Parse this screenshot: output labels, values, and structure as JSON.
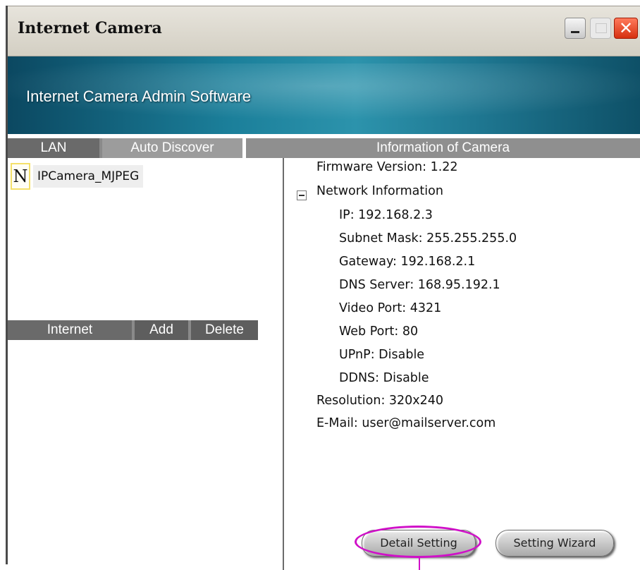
{
  "window": {
    "title": "Internet Camera"
  },
  "banner": {
    "title": "Internet Camera Admin Software"
  },
  "lan_bar": {
    "lan_label": "LAN",
    "auto_discover_label": "Auto Discover"
  },
  "camera_list": [
    {
      "icon_letter": "N",
      "name": "IPCamera_MJPEG"
    }
  ],
  "internet_bar": {
    "internet_label": "Internet",
    "add_label": "Add",
    "delete_label": "Delete"
  },
  "info_panel": {
    "header": "Information of Camera",
    "firmware": "Firmware Version:  1.22",
    "network_group": "Network Information",
    "network": [
      "IP:  192.168.2.3",
      "Subnet Mask:  255.255.255.0",
      "Gateway:  192.168.2.1",
      "DNS Server:  168.95.192.1",
      "Video Port:  4321",
      "Web Port:  80",
      "UPnP:  Disable",
      "DDNS:  Disable"
    ],
    "resolution": "Resolution: 320x240",
    "email": "E-Mail: user@mailserver.com"
  },
  "buttons": {
    "detail_setting": "Detail Setting",
    "setting_wizard": "Setting Wizard"
  },
  "colors": {
    "highlight_ring": "#d010c8",
    "banner": "#1b7f9a"
  }
}
